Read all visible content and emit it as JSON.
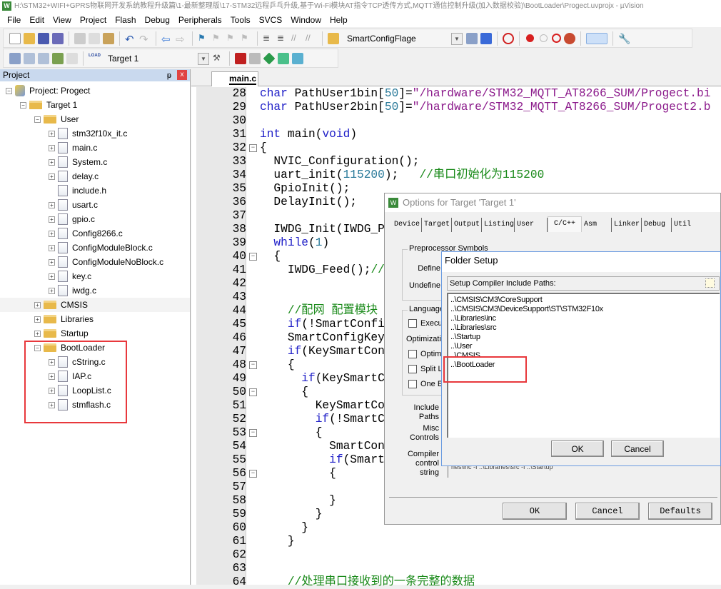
{
  "window": {
    "title": "H:\\STM32+WIFI+GPRS物联网开发系统教程升级篇\\1-最新整理版\\17-STM32远程乒乓升级,基于Wi-Fi模块AT指令TCP透传方式,MQTT通信控制升级(加入数据校验)\\BootLoader\\Progect.uvprojx - µVision",
    "app_icon": "W"
  },
  "menu": [
    "File",
    "Edit",
    "View",
    "Project",
    "Flash",
    "Debug",
    "Peripherals",
    "Tools",
    "SVCS",
    "Window",
    "Help"
  ],
  "toolbar": {
    "find_combo": "SmartConfigFlage",
    "target_combo": "Target 1",
    "load_label": "LOAD"
  },
  "project": {
    "title": "Project",
    "pin": "ᵽ",
    "close": "x",
    "tree": [
      {
        "label": "Project: Progect",
        "level": 0,
        "icon": "project",
        "exp": "-"
      },
      {
        "label": "Target 1",
        "level": 1,
        "icon": "target",
        "exp": "-"
      },
      {
        "label": "User",
        "level": 2,
        "icon": "folder",
        "exp": "-"
      },
      {
        "label": "stm32f10x_it.c",
        "level": 3,
        "icon": "file",
        "exp": "+"
      },
      {
        "label": "main.c",
        "level": 3,
        "icon": "file",
        "exp": "+"
      },
      {
        "label": "System.c",
        "level": 3,
        "icon": "file",
        "exp": "+"
      },
      {
        "label": "delay.c",
        "level": 3,
        "icon": "file",
        "exp": "+"
      },
      {
        "label": "include.h",
        "level": 3,
        "icon": "file",
        "exp": ""
      },
      {
        "label": "usart.c",
        "level": 3,
        "icon": "file",
        "exp": "+"
      },
      {
        "label": "gpio.c",
        "level": 3,
        "icon": "file",
        "exp": "+"
      },
      {
        "label": "Config8266.c",
        "level": 3,
        "icon": "file",
        "exp": "+"
      },
      {
        "label": "ConfigModuleBlock.c",
        "level": 3,
        "icon": "file",
        "exp": "+"
      },
      {
        "label": "ConfigModuleNoBlock.c",
        "level": 3,
        "icon": "file",
        "exp": "+"
      },
      {
        "label": "key.c",
        "level": 3,
        "icon": "file",
        "exp": "+"
      },
      {
        "label": "iwdg.c",
        "level": 3,
        "icon": "file",
        "exp": "+"
      },
      {
        "label": "CMSIS",
        "level": 2,
        "icon": "folder",
        "exp": "+",
        "highlight": true
      },
      {
        "label": "Libraries",
        "level": 2,
        "icon": "folder",
        "exp": "+"
      },
      {
        "label": "Startup",
        "level": 2,
        "icon": "folder",
        "exp": "+"
      },
      {
        "label": "BootLoader",
        "level": 2,
        "icon": "folder",
        "exp": "-"
      },
      {
        "label": "cString.c",
        "level": 3,
        "icon": "file",
        "exp": "+"
      },
      {
        "label": "IAP.c",
        "level": 3,
        "icon": "file",
        "exp": "+"
      },
      {
        "label": "LoopList.c",
        "level": 3,
        "icon": "file",
        "exp": "+"
      },
      {
        "label": "stmflash.c",
        "level": 3,
        "icon": "file",
        "exp": "+"
      }
    ]
  },
  "editor": {
    "tab": "main.c",
    "lines": [
      {
        "n": "28",
        "t": [
          [
            "kw",
            "char"
          ],
          [
            "id",
            " PathUser1bin["
          ],
          [
            "num",
            "50"
          ],
          [
            "id",
            "]="
          ],
          [
            "str",
            "\"/hardware/STM32_MQTT_AT8266_SUM/Progect.bi"
          ]
        ]
      },
      {
        "n": "29",
        "t": [
          [
            "kw",
            "char"
          ],
          [
            "id",
            " PathUser2bin["
          ],
          [
            "num",
            "50"
          ],
          [
            "id",
            "]="
          ],
          [
            "str",
            "\"/hardware/STM32_MQTT_AT8266_SUM/Progect2.b"
          ]
        ]
      },
      {
        "n": "30",
        "t": []
      },
      {
        "n": "31",
        "t": [
          [
            "kw",
            "int"
          ],
          [
            "id",
            " main("
          ],
          [
            "kw",
            "void"
          ],
          [
            "id",
            ")"
          ]
        ]
      },
      {
        "n": "32",
        "fold": true,
        "t": [
          [
            "id",
            "{"
          ]
        ]
      },
      {
        "n": "33",
        "t": [
          [
            "id",
            "  NVIC_Configuration();"
          ]
        ]
      },
      {
        "n": "34",
        "t": [
          [
            "id",
            "  uart_init("
          ],
          [
            "num",
            "115200"
          ],
          [
            "id",
            ");   "
          ],
          [
            "cm",
            "//串口初始化为115200"
          ]
        ]
      },
      {
        "n": "35",
        "t": [
          [
            "id",
            "  GpioInit();"
          ]
        ]
      },
      {
        "n": "36",
        "t": [
          [
            "id",
            "  DelayInit();"
          ]
        ]
      },
      {
        "n": "37",
        "t": []
      },
      {
        "n": "38",
        "t": [
          [
            "id",
            "  IWDG_Init(IWDG_P"
          ]
        ]
      },
      {
        "n": "39",
        "t": [
          [
            "kw",
            "  while"
          ],
          [
            "id",
            "("
          ],
          [
            "num",
            "1"
          ],
          [
            "id",
            ")"
          ]
        ]
      },
      {
        "n": "40",
        "fold": true,
        "t": [
          [
            "id",
            "  {"
          ]
        ]
      },
      {
        "n": "41",
        "t": [
          [
            "id",
            "    IWDG_Feed();"
          ],
          [
            "cm",
            "//"
          ]
        ]
      },
      {
        "n": "42",
        "t": []
      },
      {
        "n": "43",
        "t": []
      },
      {
        "n": "44",
        "t": [
          [
            "cm",
            "    //配网 配置模块"
          ]
        ]
      },
      {
        "n": "45",
        "t": [
          [
            "kw",
            "    if"
          ],
          [
            "id",
            "(!SmartConfi"
          ]
        ]
      },
      {
        "n": "46",
        "t": [
          [
            "id",
            "    SmartConfigKey"
          ]
        ]
      },
      {
        "n": "47",
        "t": [
          [
            "kw",
            "    if"
          ],
          [
            "id",
            "(KeySmartCon"
          ]
        ]
      },
      {
        "n": "48",
        "fold": true,
        "t": [
          [
            "id",
            "    {"
          ]
        ]
      },
      {
        "n": "49",
        "t": [
          [
            "kw",
            "      if"
          ],
          [
            "id",
            "(KeySmartC"
          ]
        ]
      },
      {
        "n": "50",
        "fold": true,
        "t": [
          [
            "id",
            "      {"
          ]
        ]
      },
      {
        "n": "51",
        "t": [
          [
            "id",
            "        KeySmartCo"
          ]
        ]
      },
      {
        "n": "52",
        "t": [
          [
            "kw",
            "        if"
          ],
          [
            "id",
            "(!SmartC"
          ]
        ]
      },
      {
        "n": "53",
        "fold": true,
        "t": [
          [
            "id",
            "        {"
          ]
        ]
      },
      {
        "n": "54",
        "t": [
          [
            "id",
            "          SmartCon"
          ]
        ]
      },
      {
        "n": "55",
        "t": [
          [
            "kw",
            "          if"
          ],
          [
            "id",
            "(Smart"
          ]
        ]
      },
      {
        "n": "56",
        "fold": true,
        "t": [
          [
            "id",
            "          {"
          ]
        ]
      },
      {
        "n": "57",
        "t": []
      },
      {
        "n": "58",
        "t": [
          [
            "id",
            "          }"
          ]
        ]
      },
      {
        "n": "59",
        "t": [
          [
            "id",
            "        }"
          ]
        ]
      },
      {
        "n": "60",
        "t": [
          [
            "id",
            "      }"
          ]
        ]
      },
      {
        "n": "61",
        "t": [
          [
            "id",
            "    }"
          ]
        ]
      },
      {
        "n": "62",
        "t": []
      },
      {
        "n": "63",
        "t": []
      },
      {
        "n": "64",
        "t": [
          [
            "cm",
            "    //处理串口接收到的一条完整的数据"
          ]
        ]
      }
    ]
  },
  "options": {
    "title": "Options for Target 'Target 1'",
    "tabs": [
      "Device",
      "Target",
      "Output",
      "Listing",
      "User",
      "C/C++",
      "Asm",
      "Linker",
      "Debug",
      "Util"
    ],
    "active_tab": "C/C++",
    "preprocessor": "Preprocessor Symbols",
    "define": "Define",
    "undefine": "Undefine",
    "language": "Language",
    "execu": "Execu",
    "optimization": "Optimizatio",
    "optimi": "Optimi",
    "split": "Split L",
    "one": "One E",
    "include_paths": [
      "Include",
      "Paths"
    ],
    "misc": [
      "Misc",
      "Controls"
    ],
    "compiler": [
      "Compiler",
      "control",
      "string"
    ],
    "compiler_string": "cortex-m3 -g -O0 --apcs=interwork -I ..\\CMSIS\\CM3\\DeviceSupport\\ST\\STM32F10x -I ..\\Libraries\\inc -I ..\\Libraries\\src -I ..\\Startup",
    "ok": "OK",
    "cancel": "Cancel",
    "defaults": "Defaults"
  },
  "folder_setup": {
    "title": "Folder Setup",
    "header": "Setup Compiler Include Paths:",
    "paths": [
      "..\\CMSIS\\CM3\\CoreSupport",
      "..\\CMSIS\\CM3\\DeviceSupport\\ST\\STM32F10x",
      "..\\Libraries\\inc",
      "..\\Libraries\\src",
      "..\\Startup",
      "..\\User",
      "..\\CMSIS",
      "..\\BootLoader"
    ],
    "ok": "OK",
    "cancel": "Cancel"
  },
  "colors": {
    "highlight_box": "#e8383c",
    "keyword": "#2020c8",
    "string": "#8b1a8b",
    "comment": "#1a8a1a",
    "number": "#2a7a9a"
  }
}
